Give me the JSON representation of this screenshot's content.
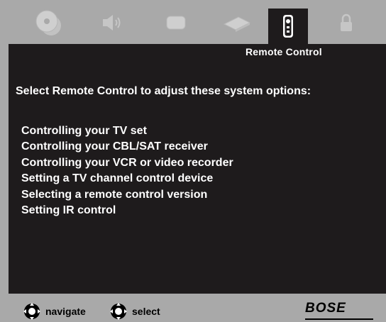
{
  "tabs": [
    {
      "icon": "disc-icon",
      "active": false
    },
    {
      "icon": "speaker-icon",
      "active": false
    },
    {
      "icon": "display-icon",
      "active": false
    },
    {
      "icon": "wand-icon",
      "active": false
    },
    {
      "icon": "remote-icon",
      "active": true
    },
    {
      "icon": "lock-icon",
      "active": false
    }
  ],
  "section_title": "Remote Control",
  "prompt": "Select Remote Control to adjust these system options:",
  "menu": [
    "Controlling your TV set",
    "Controlling your CBL/SAT receiver",
    "Controlling your VCR or video recorder",
    "Setting a TV channel control device",
    "Selecting a remote control version",
    "Setting IR control"
  ],
  "footer": {
    "navigate_label": "navigate",
    "select_label": "select",
    "brand": "BOSE"
  },
  "colors": {
    "background": "#a9a9a9",
    "panel": "#1e1b1c",
    "text": "#ffffff",
    "inactive_icon": "#bdbdbd"
  }
}
